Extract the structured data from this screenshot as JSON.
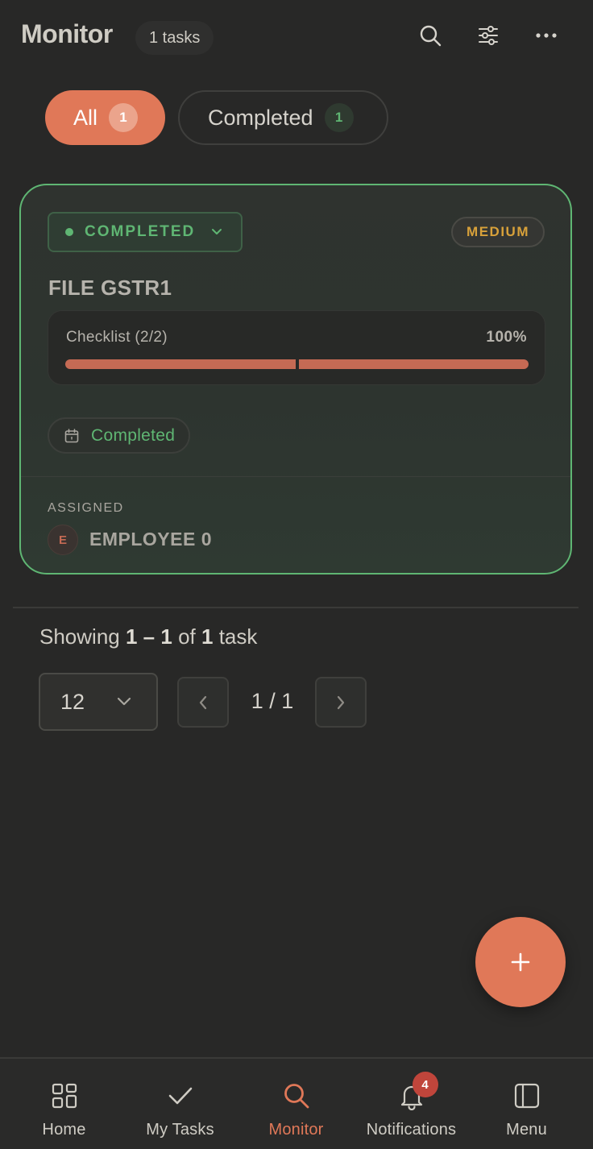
{
  "header": {
    "title": "Monitor",
    "task_count": "1 tasks",
    "icons": [
      "search-icon",
      "filter-sliders-icon",
      "more-horizontal-icon"
    ]
  },
  "tabs": [
    {
      "label": "All",
      "count": "1",
      "active": true
    },
    {
      "label": "Completed",
      "count": "1",
      "active": false
    }
  ],
  "task_card": {
    "status": "COMPLETED",
    "priority": "MEDIUM",
    "title": "FILE GSTR1",
    "checklist_label": "Checklist (2/2)",
    "checklist_percent": "100%",
    "checklist_done": 2,
    "checklist_total": 2,
    "due_label": "Completed",
    "assigned_label": "ASSIGNED",
    "assignee_initial": "E",
    "assignee_name": "EMPLOYEE 0"
  },
  "pagination": {
    "showing_prefix": "Showing",
    "range_start": "1",
    "range_dash": "–",
    "range_end": "1",
    "of_word": "of",
    "total": "1",
    "unit": "task",
    "page_size": "12",
    "page_indicator": "1 / 1"
  },
  "bottom_nav": [
    {
      "label": "Home",
      "icon": "grid-icon"
    },
    {
      "label": "My Tasks",
      "icon": "check-icon"
    },
    {
      "label": "Monitor",
      "icon": "search-icon",
      "active": true
    },
    {
      "label": "Notifications",
      "icon": "bell-icon",
      "badge": "4"
    },
    {
      "label": "Menu",
      "icon": "sidebar-panel-icon"
    }
  ],
  "colors": {
    "accent": "#e07858",
    "success": "#5fb673",
    "warning": "#d8a13a",
    "background": "#282827"
  }
}
